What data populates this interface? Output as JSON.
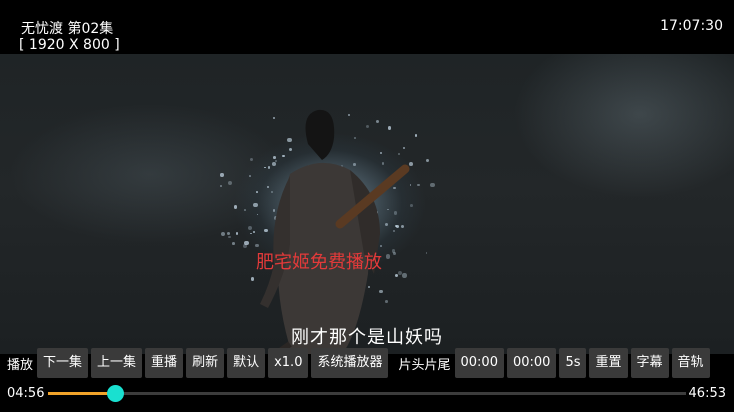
{
  "header": {
    "title": "无忧渡 第02集",
    "resolution": "[ 1920 X 800 ]",
    "clock": "17:07:30"
  },
  "overlay": {
    "watermark": "肥宅姬免费播放",
    "subtitle": "刚才那个是山妖吗"
  },
  "controls": {
    "play_label": "播放",
    "next": "下一集",
    "prev": "上一集",
    "replay": "重播",
    "refresh": "刷新",
    "default": "默认",
    "speed": "x1.0",
    "system_player": "系统播放器",
    "intro_outro_label": "片头片尾",
    "intro_time": "00:00",
    "outro_time": "00:00",
    "step": "5s",
    "reset": "重置",
    "subtitle_btn": "字幕",
    "audio_track": "音轨"
  },
  "progress": {
    "current": "04:56",
    "total": "46:53",
    "fraction": 0.1053,
    "fill_color": "#f0a32a",
    "thumb_color": "#19e0d0"
  },
  "colors": {
    "watermark": "#e23a3a",
    "button_bg": "#3a3a3a"
  }
}
